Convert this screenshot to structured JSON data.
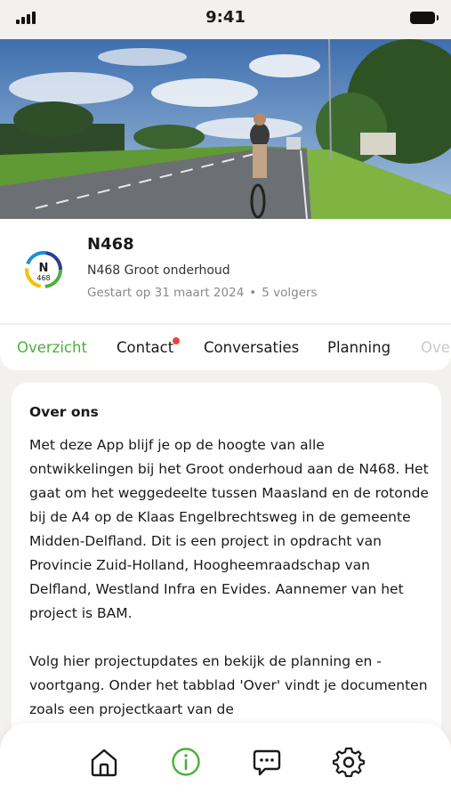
{
  "status_bar": {
    "time": "9:41"
  },
  "project": {
    "logo_text": "N",
    "logo_subtext": "468",
    "title": "N468",
    "subtitle": "N468 Groot onderhoud",
    "started": "Gestart op 31 maart 2024",
    "separator": "•",
    "followers": "5 volgers"
  },
  "tabs": [
    {
      "label": "Overzicht",
      "active": true
    },
    {
      "label": "Contact",
      "has_notification": true
    },
    {
      "label": "Conversaties"
    },
    {
      "label": "Planning"
    },
    {
      "label": "Over"
    }
  ],
  "about": {
    "heading": "Over ons",
    "paragraphs": [
      "Met deze App blijf je op de hoogte van alle ontwikkelingen bij het Groot onderhoud aan de N468. Het gaat om het weggedeelte tussen Maasland en de rotonde bij de A4 op de Klaas Engelbrechtsweg in de gemeente Midden-Delfland. Dit is een project in opdracht van Provincie Zuid-Holland, Hoogheemraadschap van Delfland, Westland Infra en Evides. Aannemer van het project is BAM.",
      "Volg hier projectupdates en bekijk de planning en -voortgang. Onder het tabblad 'Over' vindt je documenten zoals een projectkaart van de"
    ]
  },
  "bottom_nav": [
    {
      "icon": "home-icon"
    },
    {
      "icon": "info-icon",
      "active": true
    },
    {
      "icon": "chat-icon"
    },
    {
      "icon": "settings-icon"
    }
  ],
  "colors": {
    "accent": "#4caf3d",
    "notification": "#e6453c",
    "background": "#f2f1ef"
  }
}
